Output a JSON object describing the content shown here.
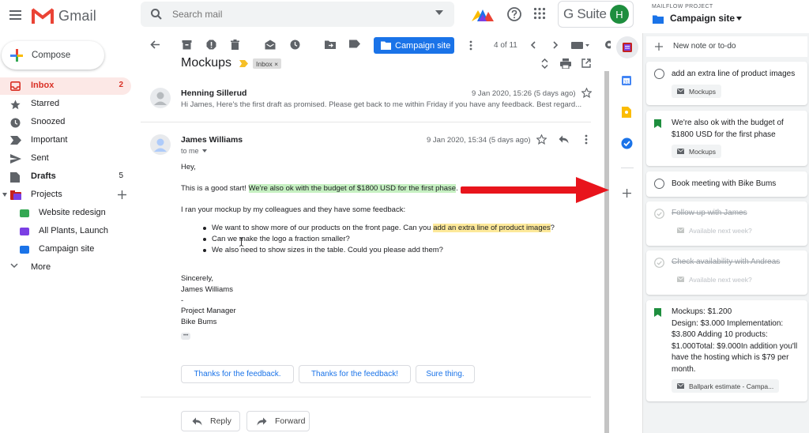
{
  "header": {
    "app_name": "Gmail",
    "search_placeholder": "Search mail",
    "gsuite_label": "G Suite",
    "avatar_letter": "H"
  },
  "sidebar": {
    "compose": "Compose",
    "items": [
      {
        "label": "Inbox",
        "count": "2"
      },
      {
        "label": "Starred",
        "count": ""
      },
      {
        "label": "Snoozed",
        "count": ""
      },
      {
        "label": "Important",
        "count": ""
      },
      {
        "label": "Sent",
        "count": ""
      },
      {
        "label": "Drafts",
        "count": "5"
      },
      {
        "label": "Projects",
        "count": ""
      }
    ],
    "projects": [
      {
        "label": "Website redesign",
        "color": "#34a853"
      },
      {
        "label": "All Plants, Launch",
        "color": "#7b3fe4"
      },
      {
        "label": "Campaign site",
        "color": "#1a73e8"
      }
    ],
    "more": "More"
  },
  "toolbar": {
    "label_chip": "Campaign site",
    "pager": "4 of 11"
  },
  "thread": {
    "subject": "Mockups",
    "inbox_chip": "Inbox ×",
    "message1": {
      "sender": "Henning Sillerud",
      "date": "9 Jan 2020, 15:26 (5 days ago)",
      "snippet": "Hi James, Here's the first draft as promised. Please get back to me within Friday if you have any feedback. Best regard..."
    },
    "message2": {
      "sender": "James Williams",
      "to": "to me",
      "date": "9 Jan 2020, 15:34 (5 days ago)",
      "greeting": "Hey,",
      "line1_pre": "This is a good start! ",
      "line1_hl": "We're also ok with the budget of $1800 USD for the first phase",
      "line1_post": ".",
      "line2": "I ran your mockup by my colleagues and they have some feedback:",
      "bullet1_pre": "We want to show more of our products on the front page. Can you ",
      "bullet1_hl": "add an extra line of product images",
      "bullet1_post": "?",
      "bullet2": "Can we make the logo a fraction smaller?",
      "bullet3": "We also need to show sizes in the table. Could you please add them?",
      "sign1": "Sincerely,",
      "sign2": "James Williams",
      "sign3": "-",
      "sign4": "Project Manager",
      "sign5": "Bike Bums",
      "ellipsis": "•••"
    },
    "suggestions": [
      "Thanks for the feedback.",
      "Thanks for the feedback!",
      "Sure thing."
    ],
    "reply": "Reply",
    "forward": "Forward"
  },
  "panel": {
    "kicker": "MAILFLOW PROJECT",
    "title": "Campaign site",
    "new_note": "New note or to-do",
    "cards": [
      {
        "text": "add an extra line of product images",
        "chip": "Mockups"
      },
      {
        "text": "We're also ok with the budget of\n$1800 USD for the first phase",
        "chip": "Mockups"
      },
      {
        "text": "Book meeting with Bike Bums",
        "chip": ""
      },
      {
        "text": "Follow up with James",
        "chip": "Available next week?"
      },
      {
        "text": "Check availability with Andreas",
        "chip": "Available next week?"
      },
      {
        "text": "Mockups: $1.200\nDesign: $3.000 Implementation:\n$3.800 Adding 10 products:\n$1.000Total: $9.000In addition you'll\nhave the hosting which is $79 per\nmonth.",
        "chip": "Ballpark estimate - Campa..."
      }
    ]
  },
  "colors": {
    "accent": "#1a73e8",
    "inbox_active_bg": "#fce8e6",
    "inbox_active_text": "#d93025",
    "highlight_green": "#c6f0c2",
    "highlight_yellow": "#fde99a",
    "arrow_red": "#e8141c",
    "bookmark_green": "#1e8e3e"
  }
}
